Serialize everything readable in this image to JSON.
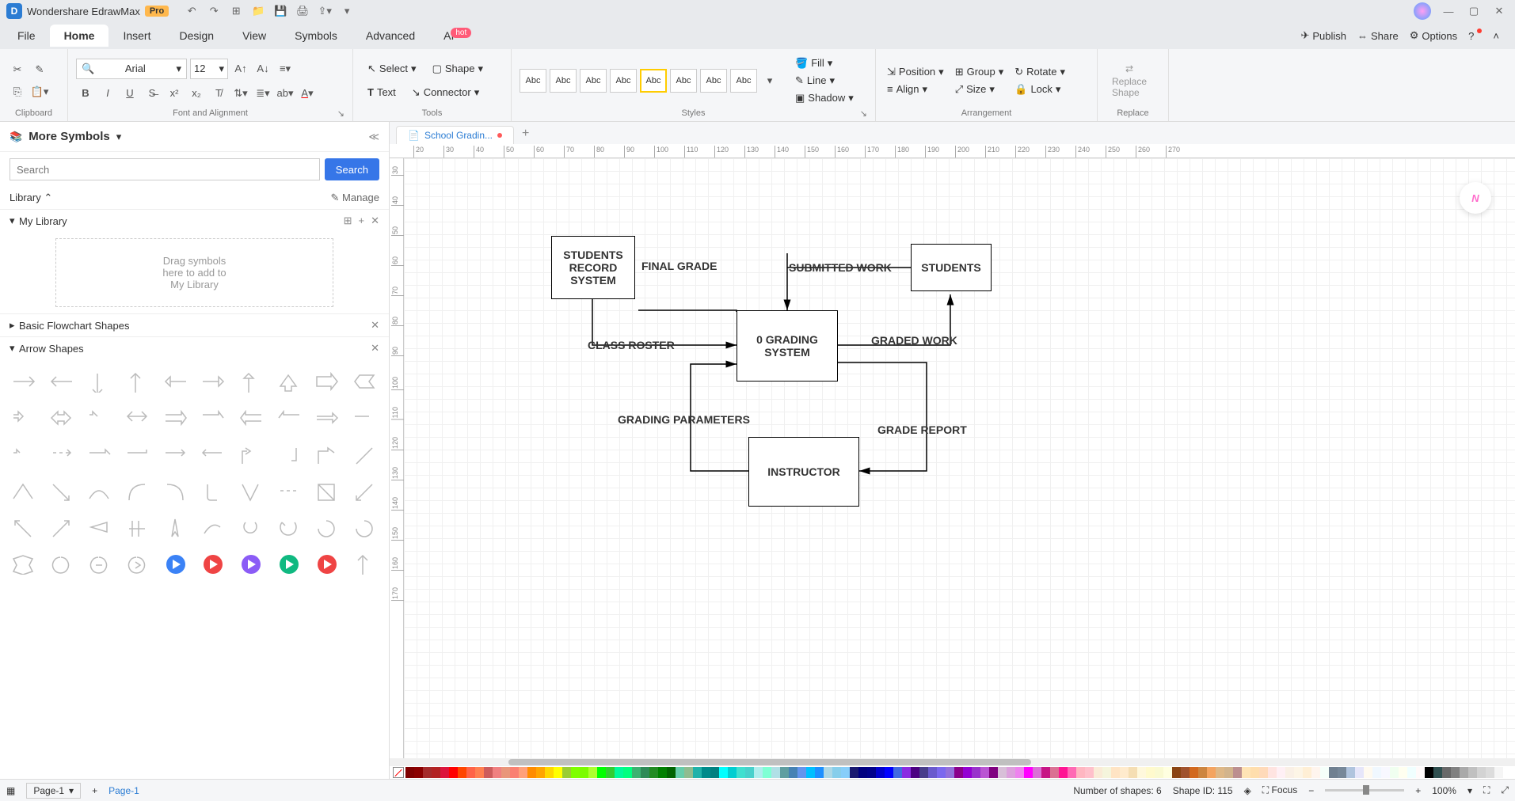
{
  "app": {
    "title": "Wondershare EdrawMax",
    "pro": "Pro"
  },
  "menu": {
    "tabs": [
      "File",
      "Home",
      "Insert",
      "Design",
      "View",
      "Symbols",
      "Advanced",
      "AI"
    ],
    "active": 1,
    "hot": "hot",
    "right": {
      "publish": "Publish",
      "share": "Share",
      "options": "Options"
    }
  },
  "ribbon": {
    "clipboard": "Clipboard",
    "font_align": "Font and Alignment",
    "tools": "Tools",
    "styles": "Styles",
    "arrangement": "Arrangement",
    "replace": "Replace",
    "font": "Arial",
    "size": "12",
    "select": "Select",
    "shape": "Shape",
    "text": "Text",
    "connector": "Connector",
    "abc": "Abc",
    "fill": "Fill",
    "line": "Line",
    "shadow": "Shadow",
    "position": "Position",
    "align": "Align",
    "group": "Group",
    "size_b": "Size",
    "rotate": "Rotate",
    "lock": "Lock",
    "replace_shape": "Replace\nShape"
  },
  "sidebar": {
    "title": "More Symbols",
    "search_ph": "Search",
    "search_btn": "Search",
    "library": "Library",
    "manage": "Manage",
    "mylib": "My Library",
    "dropzone": "Drag symbols\nhere to add to\nMy Library",
    "basic": "Basic Flowchart Shapes",
    "arrow": "Arrow Shapes"
  },
  "doc": {
    "tab": "School Gradin..."
  },
  "ruler_h": [
    20,
    30,
    40,
    50,
    60,
    70,
    80,
    90,
    100,
    110,
    120,
    130,
    140,
    150,
    160,
    170,
    180,
    190,
    200,
    210,
    220,
    230,
    240,
    250,
    260,
    270
  ],
  "ruler_v": [
    30,
    40,
    50,
    60,
    70,
    80,
    90,
    100,
    110,
    120,
    130,
    140,
    150,
    160,
    170
  ],
  "diagram": {
    "nodes": {
      "srs": "STUDENTS\nRECORD\nSYSTEM",
      "students": "STUDENTS",
      "grading": "0\nGRADING\nSYSTEM",
      "instructor": "INSTRUCTOR"
    },
    "labels": {
      "final_grade": "FINAL\nGRADE",
      "submitted": "SUBMITTED WORK",
      "class_roster": "CLASS ROSTER",
      "graded_work": "GRADED\nWORK",
      "grading_params": "GRADING PARAMETERS",
      "grade_report": "GRADE REPORT"
    }
  },
  "colors": [
    "#800000",
    "#8b0000",
    "#a52a2a",
    "#b22222",
    "#dc143c",
    "#ff0000",
    "#ff4500",
    "#ff6347",
    "#ff7f50",
    "#cd5c5c",
    "#f08080",
    "#e9967a",
    "#fa8072",
    "#ffa07a",
    "#ff8c00",
    "#ffa500",
    "#ffd700",
    "#ffff00",
    "#9acd32",
    "#7fff00",
    "#7cfc00",
    "#adff2f",
    "#00ff00",
    "#32cd32",
    "#00fa9a",
    "#00ff7f",
    "#3cb371",
    "#2e8b57",
    "#228b22",
    "#008000",
    "#006400",
    "#66cdaa",
    "#8fbc8f",
    "#20b2aa",
    "#008b8b",
    "#008080",
    "#00ffff",
    "#00ced1",
    "#40e0d0",
    "#48d1cc",
    "#afeeee",
    "#7fffd4",
    "#b0e0e6",
    "#5f9ea0",
    "#4682b4",
    "#6495ed",
    "#00bfff",
    "#1e90ff",
    "#add8e6",
    "#87ceeb",
    "#87cefa",
    "#191970",
    "#000080",
    "#00008b",
    "#0000cd",
    "#0000ff",
    "#4169e1",
    "#8a2be2",
    "#4b0082",
    "#483d8b",
    "#6a5acd",
    "#7b68ee",
    "#9370db",
    "#8b008b",
    "#9400d3",
    "#9932cc",
    "#ba55d3",
    "#800080",
    "#d8bfd8",
    "#dda0dd",
    "#ee82ee",
    "#ff00ff",
    "#da70d6",
    "#c71585",
    "#db7093",
    "#ff1493",
    "#ff69b4",
    "#ffb6c1",
    "#ffc0cb",
    "#faebd7",
    "#f5f5dc",
    "#ffe4c4",
    "#ffebcd",
    "#f5deb3",
    "#fff8dc",
    "#fffacd",
    "#fafad2",
    "#ffffe0",
    "#8b4513",
    "#a0522d",
    "#d2691e",
    "#cd853f",
    "#f4a460",
    "#deb887",
    "#d2b48c",
    "#bc8f8f",
    "#ffe4b5",
    "#ffdead",
    "#ffdab9",
    "#ffe4e1",
    "#fff0f5",
    "#faf0e6",
    "#fdf5e6",
    "#ffefd5",
    "#fff5ee",
    "#f5fffa",
    "#708090",
    "#778899",
    "#b0c4de",
    "#e6e6fa",
    "#fffaf0",
    "#f0f8ff",
    "#f8f8ff",
    "#f0fff0",
    "#fffff0",
    "#f0ffff",
    "#fffafa",
    "#000000",
    "#2f4f4f",
    "#696969",
    "#808080",
    "#a9a9a9",
    "#c0c0c0",
    "#d3d3d3",
    "#dcdcdc",
    "#f5f5f5",
    "#ffffff"
  ],
  "status": {
    "page_sel": "Page-1",
    "page_tab": "Page-1",
    "shapes": "Number of shapes: 6",
    "shape_id": "Shape ID: 115",
    "focus": "Focus",
    "zoom": "100%"
  }
}
